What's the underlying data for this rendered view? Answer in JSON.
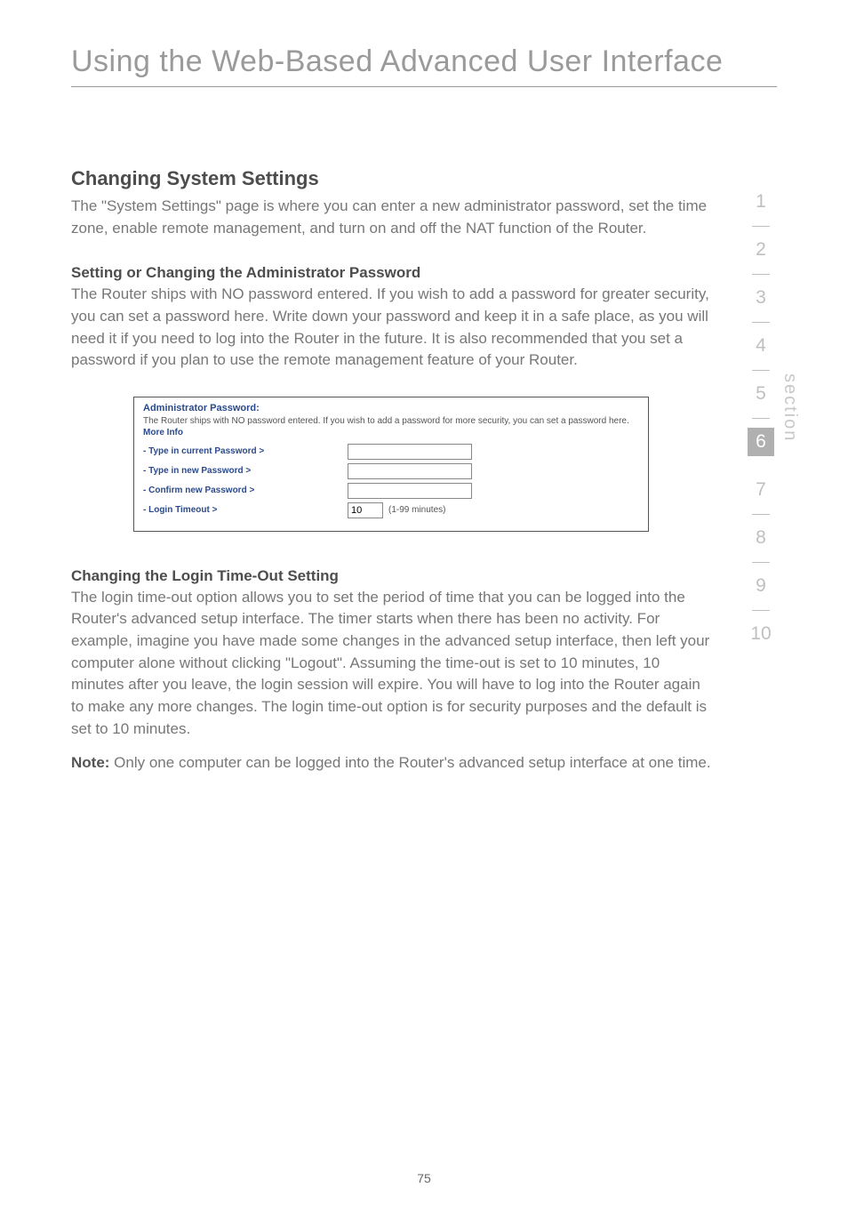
{
  "page_title": "Using the Web-Based Advanced User Interface",
  "section_nav": {
    "label": "section",
    "items": [
      "1",
      "2",
      "3",
      "4",
      "5",
      "6",
      "7",
      "8",
      "9",
      "10"
    ],
    "active_index": 5
  },
  "h1": "Changing System Settings",
  "p1": "The \"System Settings\" page is where you can enter a new administrator password, set the time zone, enable remote management, and turn on and off the NAT function of the Router.",
  "h2": "Setting or Changing the Administrator Password",
  "p2": "The Router ships with NO password entered. If you wish to add a password for greater security, you can set a password here. Write down your password and keep it in a safe place, as you will need it if you need to log into the Router in the future. It is also recommended that you set a password if you plan to use the remote management feature of your Router.",
  "admin_box": {
    "title": "Administrator Password:",
    "desc_part1": "The Router ships with NO password entered. If you wish to add a password for more security, you can set a password here. ",
    "more_info": "More Info",
    "row_current": "- Type in current Password >",
    "row_new": "- Type in new Password >",
    "row_confirm": "- Confirm new Password >",
    "row_timeout": "- Login Timeout >",
    "timeout_value": "10",
    "timeout_hint": "(1-99 minutes)"
  },
  "h3": "Changing the Login Time-Out Setting",
  "p3": "The login time-out option allows you to set the period of time that you can be logged into the Router's advanced setup interface. The timer starts when there has been no activity. For example, imagine you have made some changes in the advanced setup interface, then left your computer alone without clicking \"Logout\". Assuming the time-out is set to 10 minutes, 10 minutes after you leave, the login session will expire. You will have to log into the Router again to make any more changes. The login time-out option is for security purposes and the default is set to 10 minutes.",
  "note_label": "Note:",
  "note_text": " Only one computer can be logged into the Router's advanced setup interface at one time.",
  "page_number": "75"
}
